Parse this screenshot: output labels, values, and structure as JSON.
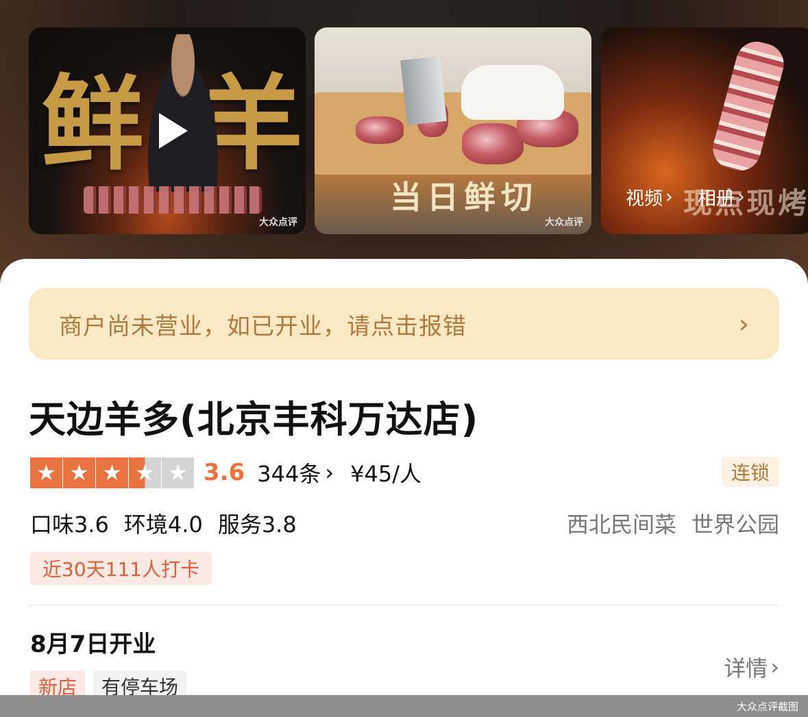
{
  "gallery": {
    "photo1": {
      "char_left": "鲜",
      "char_right": "羊",
      "watermark": "大众点评"
    },
    "photo2": {
      "caption": "当日鲜切",
      "watermark": "大众点评"
    },
    "photo3": {
      "caption": "现点现烤"
    },
    "links": {
      "video": "视频",
      "album": "相册"
    },
    "chevron": "›"
  },
  "notice": {
    "text": "商户尚未营业，如已开业，请点击报错",
    "arrow": "›"
  },
  "shop": {
    "name": "天边羊多(北京丰科万达店)",
    "rating": {
      "score": "3.6",
      "stars_filled": 3.5,
      "stars_total": 5,
      "reviews": "344条",
      "review_arrow": "›"
    },
    "price": "¥45/人",
    "chain_badge": "连锁",
    "sub_scores": [
      "口味3.6",
      "环境4.0",
      "服务3.8"
    ],
    "category": "西北民间菜",
    "area": "世界公园",
    "checkin": "近30天111人打卡",
    "open_date": "8月7日开业",
    "details_label": "详情",
    "details_arrow": "›",
    "tags": [
      "新店",
      "有停车场"
    ]
  },
  "footer": {
    "label": "大众点评截图"
  },
  "colors": {
    "accent": "#e8733e",
    "notice_bg": "#fbe9c5",
    "notice_text": "#b07a3c"
  }
}
